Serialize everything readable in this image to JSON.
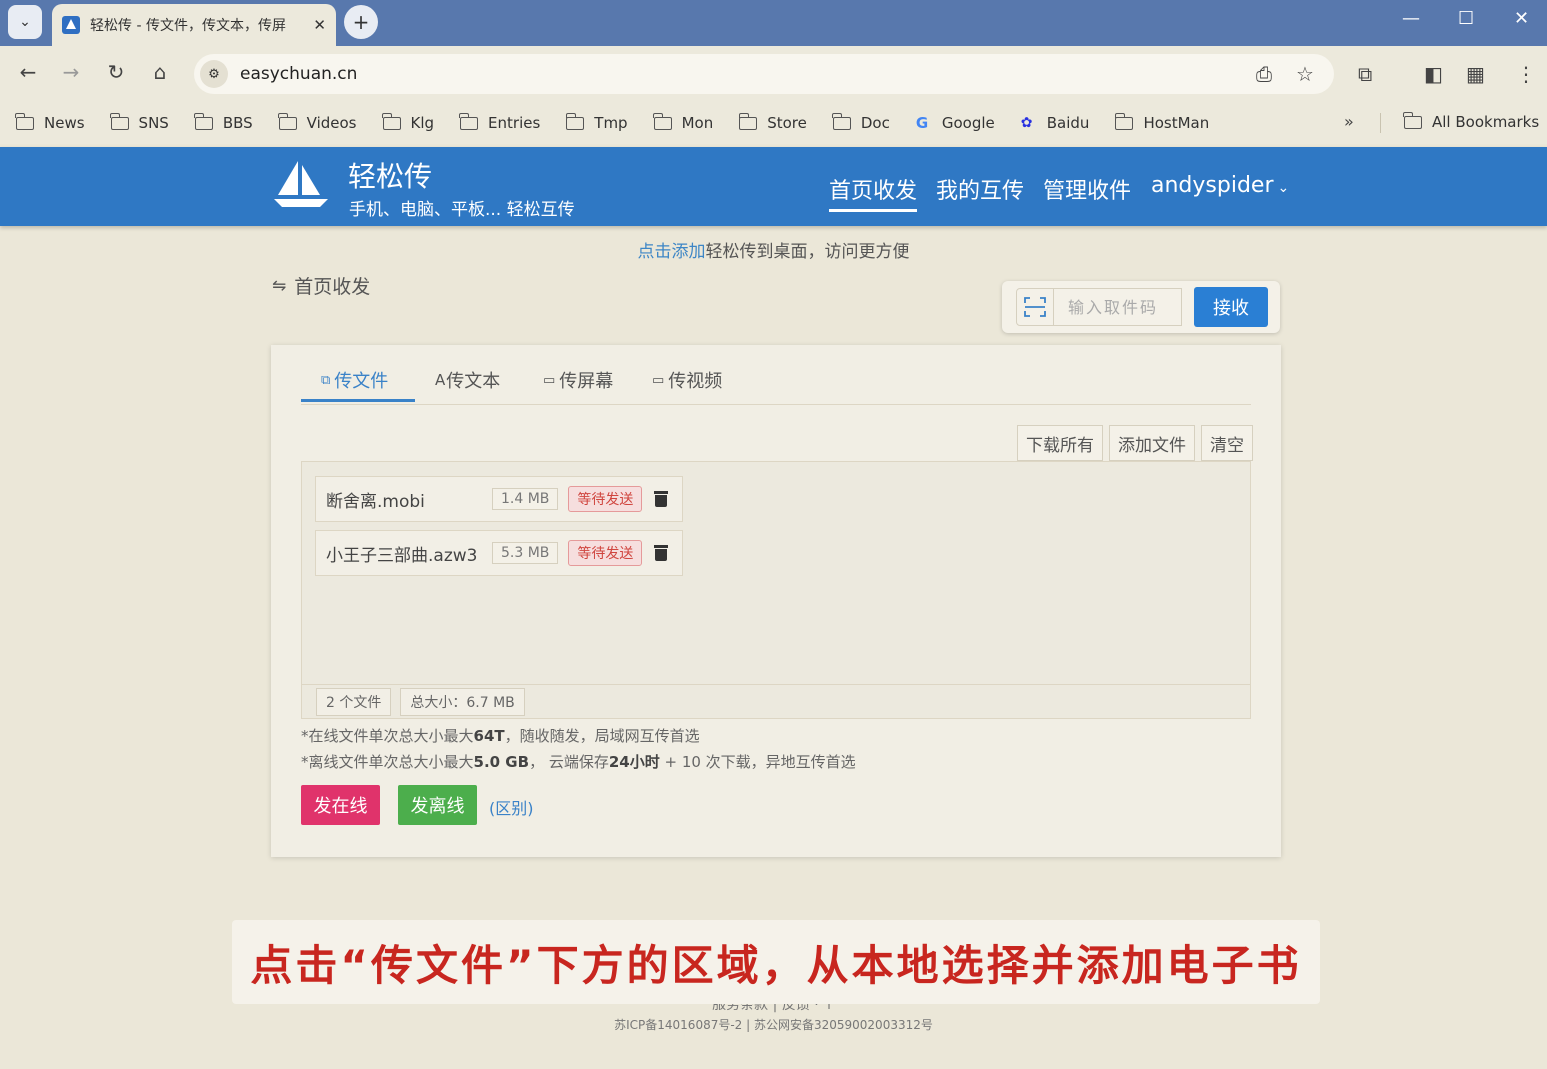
{
  "browser": {
    "tab_title": "轻松传 - 传文件，传文本，传屏",
    "url": "easychuan.cn",
    "bookmarks": [
      "News",
      "SNS",
      "BBS",
      "Videos",
      "Klg",
      "Entries",
      "Tmp",
      "Mon",
      "Store",
      "Doc",
      "Google",
      "Baidu",
      "HostMan"
    ],
    "all_bookmarks": "All Bookmarks"
  },
  "site": {
    "brand_name": "轻松传",
    "slogan": "手机、电脑、平板... 轻松互传",
    "nav": [
      "首页收发",
      "我的互传",
      "管理收件",
      "andyspider"
    ],
    "a2hs_link": "点击添加",
    "a2hs_text": "轻松传到桌面，访问更方便"
  },
  "page": {
    "breadcrumb": "首页收发",
    "pickup_placeholder": "输入取件码",
    "receive_label": "接收",
    "tabs": [
      "传文件",
      "传文本",
      "传屏幕",
      "传视频"
    ],
    "file_actions": [
      "下载所有",
      "添加文件",
      "清空"
    ],
    "files": [
      {
        "name": "断舍离.mobi",
        "size": "1.4 MB",
        "status": "等待发送"
      },
      {
        "name": "小王子三部曲.azw3",
        "size": "5.3 MB",
        "status": "等待发送"
      }
    ],
    "file_count": "2 个文件",
    "total_size": "总大小：6.7 MB",
    "note_online_pre": "*在线文件单次总大小最大",
    "note_online_bold": "64T",
    "note_online_post": "，随收随发，局域网互传首选",
    "note_offline_pre": "*离线文件单次总大小最大",
    "note_offline_bold1": "5.0 GB",
    "note_offline_mid": "， 云端保存",
    "note_offline_bold2": "24小时",
    "note_offline_post": " + 10 次下载，异地互传首选",
    "send_online": "发在线",
    "send_offline": "发离线",
    "diff_link": "(区别)"
  },
  "footer": {
    "line1": "服务条款 | 反馈 · ↑",
    "line2": "苏ICP备14016087号-2 | 苏公网安备32059002003312号"
  },
  "caption": "点击“传文件”下方的区域，从本地选择并添加电子书",
  "colors": {
    "header_blue": "#2f78c4",
    "accent_blue": "#3a82c8",
    "send_online": "#e0336b",
    "send_offline": "#4cae4c",
    "status_red": "#d0453f",
    "caption_red": "#c8261f"
  }
}
